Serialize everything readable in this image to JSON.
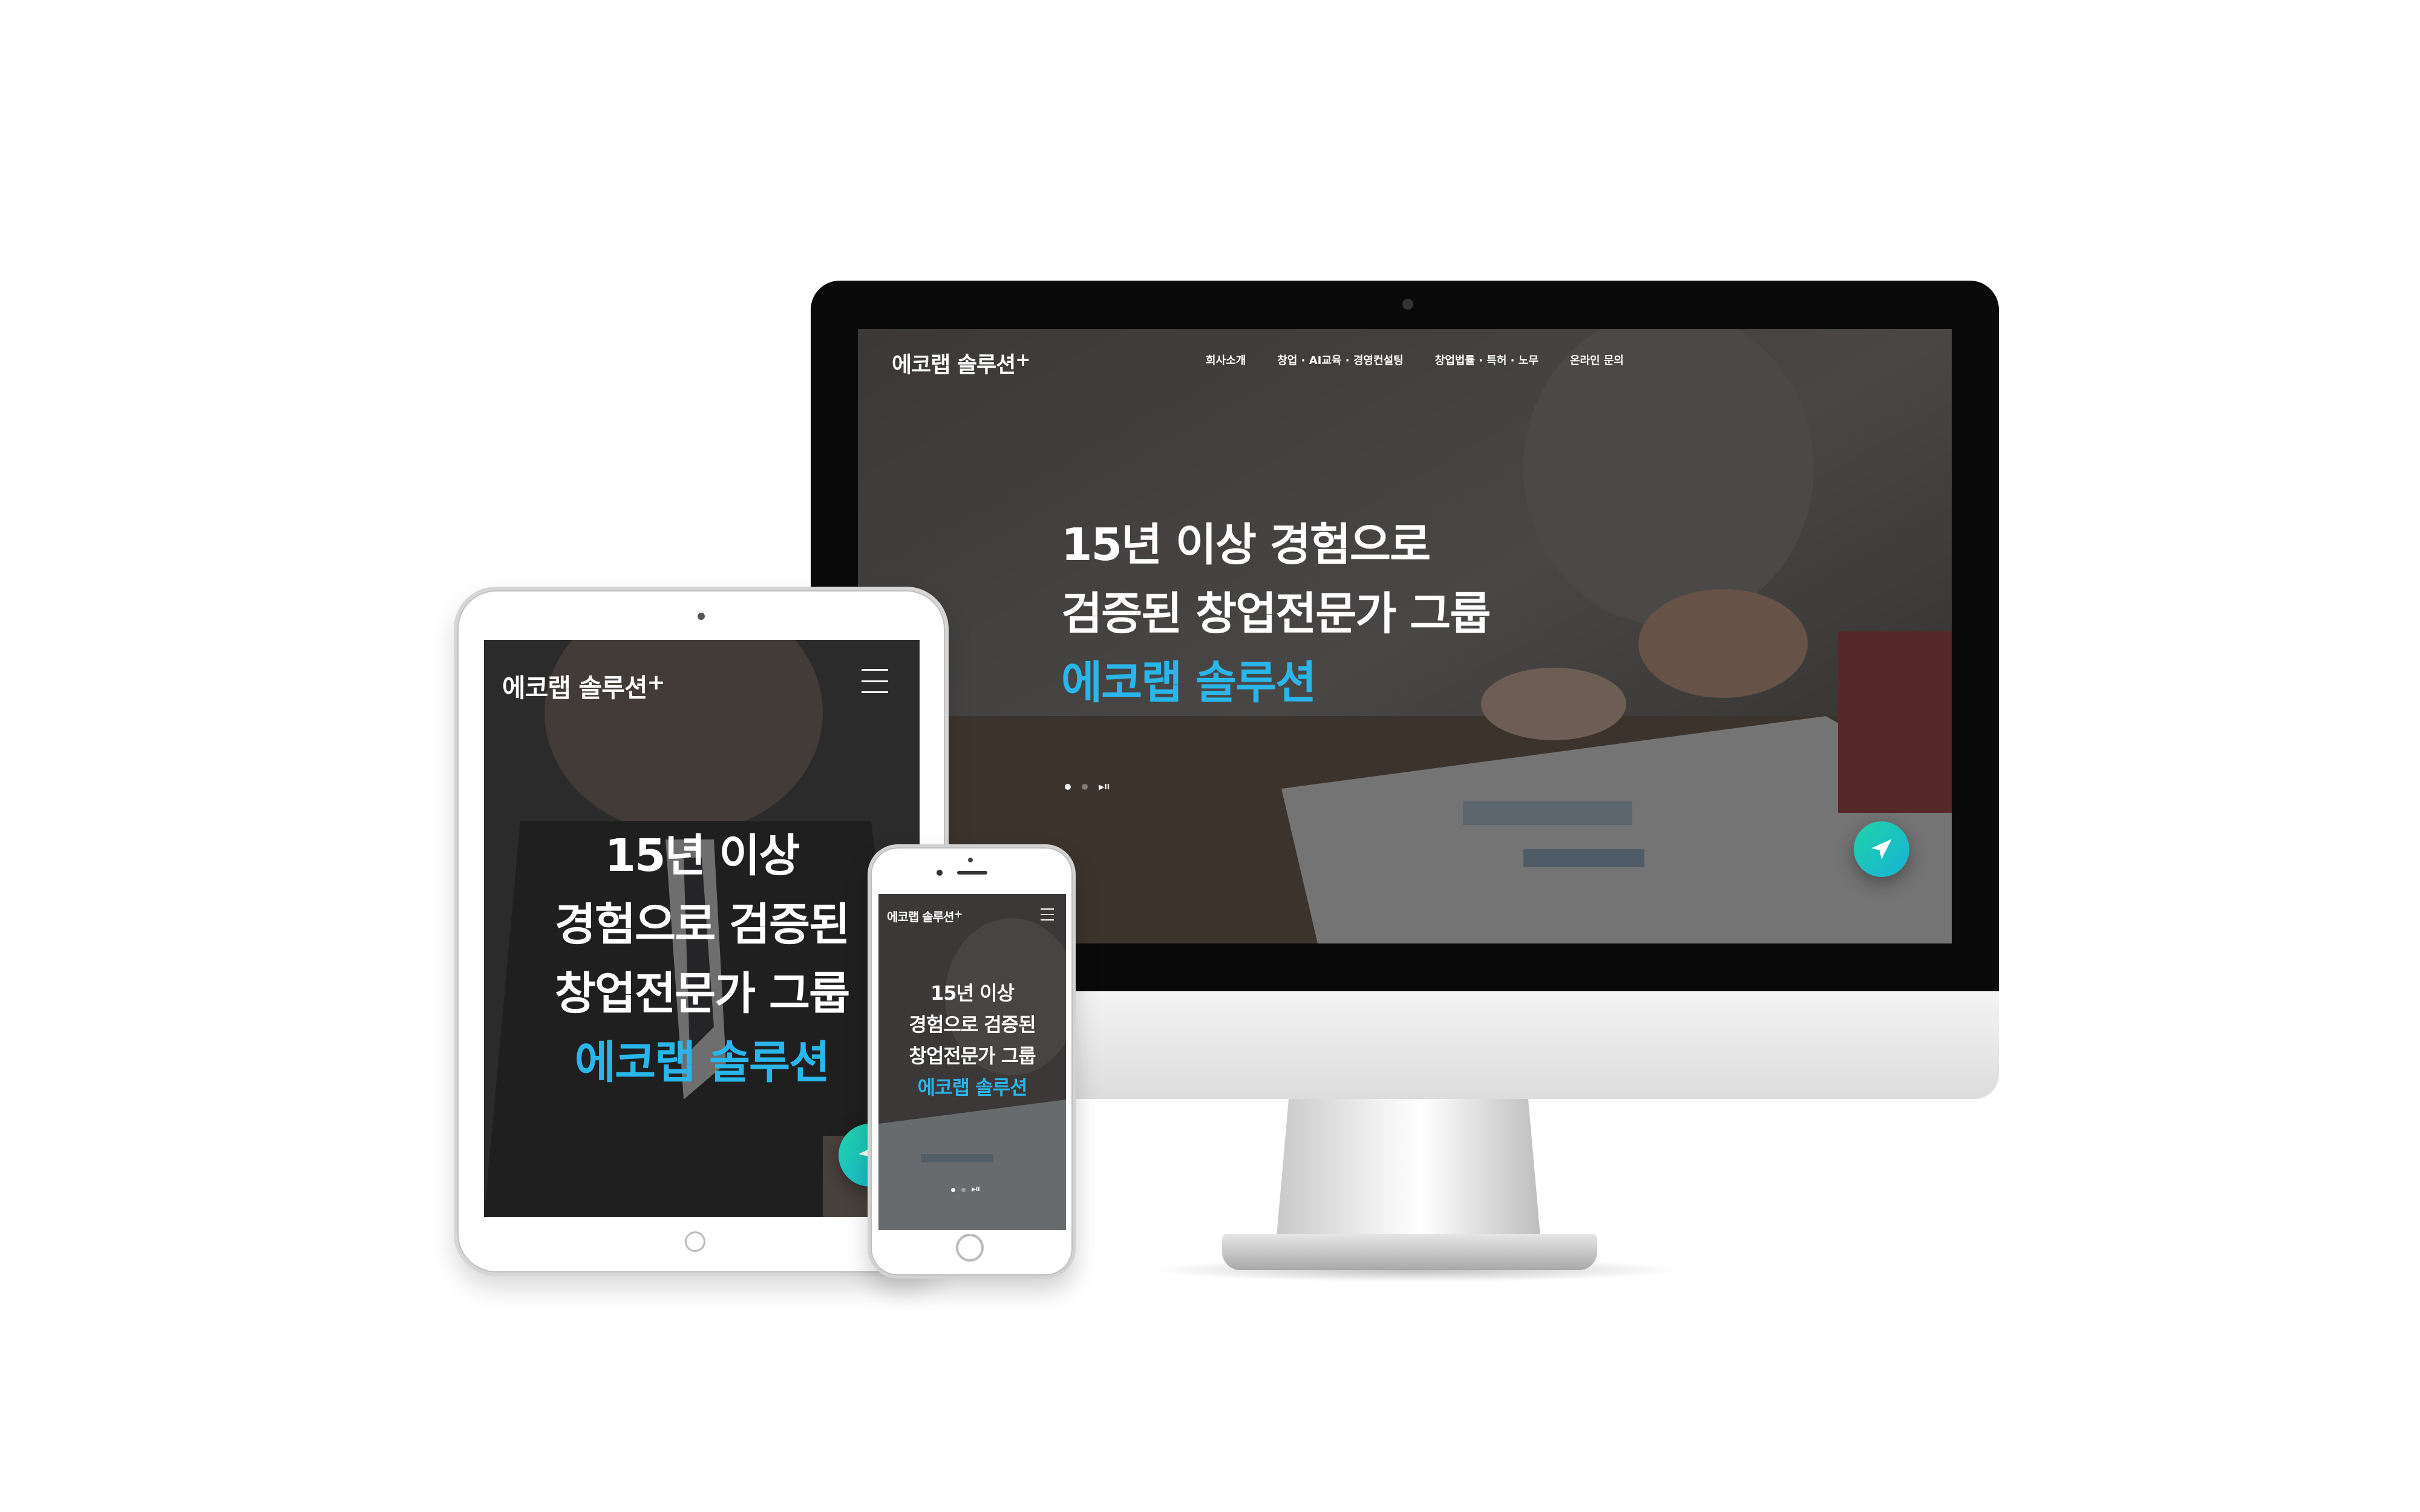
{
  "site": {
    "logo_text": "에코랩 솔루션",
    "logo_plus": "+",
    "nav": [
      "회사소개",
      "창업 · AI교육 · 경영컨설팅",
      "창업법률 · 특허 · 노무",
      "온라인 문의"
    ],
    "hero_desktop": [
      "15년 이상 경험으로",
      "검증된 창업전문가 그룹"
    ],
    "hero_tablet": [
      "15년 이상",
      "경험으로 검증된",
      "창업전문가 그룹"
    ],
    "hero_mobile": [
      "15년 이상",
      "경험으로 검증된",
      "창업전문가 그룹"
    ],
    "hero_brand": "에코랩 솔루션",
    "slider_control": "▶II",
    "accent_color": "#29b6ea",
    "fab_icon": "paper-plane-icon",
    "menu_icon": "hamburger-icon"
  }
}
